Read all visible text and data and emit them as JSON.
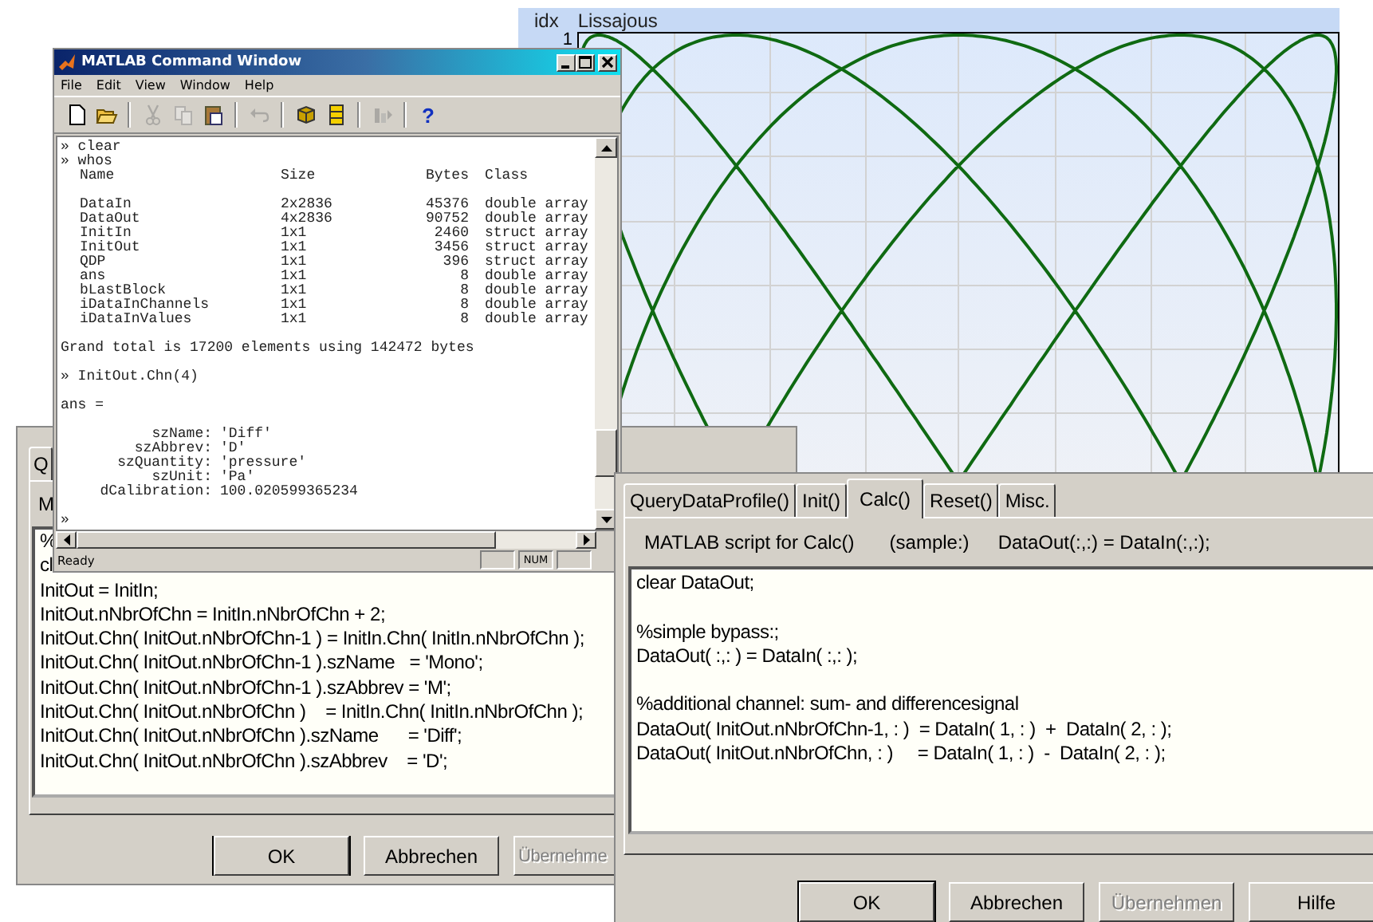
{
  "plot_window": {
    "header": {
      "column_1": "idx",
      "column_2": "Lissajous"
    },
    "y_tick": "1"
  },
  "back_dialog": {
    "tabs": [
      {
        "label": "Q",
        "selected": false
      }
    ],
    "script_label": "M",
    "editor": {
      "blocks": [
        [
          "%",
          "cl",
          "InitOut = InitIn;",
          "InitOut.nNbrOfChn = InitIn.nNbrOfChn + 2;",
          "InitOut.Chn( InitOut.nNbrOfChn-1 ) = InitIn.Chn( InitIn.nNbrOfChn );",
          "InitOut.Chn( InitOut.nNbrOfChn-1 ).szName   = 'Mono';",
          "InitOut.Chn( InitOut.nNbrOfChn-1 ).szAbbrev = 'M';",
          "InitOut.Chn( InitOut.nNbrOfChn )    = InitIn.Chn( InitIn.nNbrOfChn );",
          "InitOut.Chn( InitOut.nNbrOfChn ).szName      = 'Diff';",
          "InitOut.Chn( InitOut.nNbrOfChn ).szAbbrev    = 'D';"
        ]
      ]
    },
    "buttons": [
      {
        "label": "OK",
        "disabled": false,
        "default": true
      },
      {
        "label": "Abbrechen",
        "disabled": false,
        "default": false
      },
      {
        "label": "Übernehme",
        "disabled": true,
        "default": false
      }
    ]
  },
  "matlab_window": {
    "title": "MATLAB Command Window",
    "menu": [
      "File",
      "Edit",
      "View",
      "Window",
      "Help"
    ],
    "toolbar": [
      [
        {
          "kind": "new",
          "disabled": false
        },
        {
          "kind": "open",
          "disabled": false
        }
      ],
      [
        {
          "kind": "cut",
          "disabled": true
        },
        {
          "kind": "copy",
          "disabled": true
        },
        {
          "kind": "paste",
          "disabled": false
        }
      ],
      [
        {
          "kind": "undo",
          "disabled": true
        }
      ],
      [
        {
          "kind": "cube",
          "disabled": false
        },
        {
          "kind": "grid",
          "disabled": false
        }
      ],
      [
        {
          "kind": "profiler",
          "disabled": true
        }
      ],
      [
        {
          "kind": "help",
          "label": "?",
          "disabled": false
        }
      ]
    ],
    "console": [
      {
        "kind": "line",
        "text": "» clear"
      },
      {
        "kind": "line",
        "text": "» whos"
      },
      {
        "kind": "table",
        "columns": [
          "Name",
          "Size",
          "Bytes",
          "Class"
        ],
        "rows": [
          [
            "DataIn",
            "2x2836",
            "45376",
            "double array"
          ],
          [
            "DataOut",
            "4x2836",
            "90752",
            "double array"
          ],
          [
            "InitIn",
            "1x1",
            "2460",
            "struct array"
          ],
          [
            "InitOut",
            "1x1",
            "3456",
            "struct array"
          ],
          [
            "QDP",
            "1x1",
            "396",
            "struct array"
          ],
          [
            "ans",
            "1x1",
            "8",
            "double array"
          ],
          [
            "bLastBlock",
            "1x1",
            "8",
            "double array"
          ],
          [
            "iDataInChannels",
            "1x1",
            "8",
            "double array"
          ],
          [
            "iDataInValues",
            "1x1",
            "8",
            "double array"
          ]
        ]
      },
      {
        "kind": "blank"
      },
      {
        "kind": "line",
        "text": "Grand total is 17200 elements using 142472 bytes"
      },
      {
        "kind": "blank"
      },
      {
        "kind": "line",
        "text": "» InitOut.Chn(4)"
      },
      {
        "kind": "blank"
      },
      {
        "kind": "line",
        "text": "ans ="
      },
      {
        "kind": "blank"
      },
      {
        "kind": "fields",
        "items": [
          {
            "label": "szName:",
            "value": "'Diff'"
          },
          {
            "label": "szAbbrev:",
            "value": "'D'"
          },
          {
            "label": "szQuantity:",
            "value": "'pressure'"
          },
          {
            "label": "szUnit:",
            "value": "'Pa'"
          },
          {
            "label": "dCalibration:",
            "value": "100.020599365234"
          }
        ]
      },
      {
        "kind": "blank"
      },
      {
        "kind": "line",
        "text": "»"
      }
    ],
    "status": {
      "text": "Ready",
      "indicator": "NUM"
    }
  },
  "front_dialog": {
    "tabs": [
      {
        "label": "QueryDataProfile()",
        "selected": false
      },
      {
        "label": "Init()",
        "selected": false
      },
      {
        "label": "Calc()",
        "selected": true
      },
      {
        "label": "Reset()",
        "selected": false
      },
      {
        "label": "Misc.",
        "selected": false
      }
    ],
    "script_label": "MATLAB script for Calc()",
    "sample_label": "(sample:)",
    "sample_code": "DataOut(:,:) = DataIn(:,:);",
    "editor": {
      "blocks": [
        [
          "clear DataOut;"
        ],
        [
          "%simple bypass:;",
          "DataOut( :,: ) = DataIn( :,: );"
        ],
        [
          "%additional channel: sum- and differencesignal",
          "DataOut( InitOut.nNbrOfChn-1, : )  = DataIn( 1, : )  +  DataIn( 2, : );",
          "DataOut( InitOut.nNbrOfChn, : )     = DataIn( 1, : )  -  DataIn( 2, : );"
        ]
      ]
    },
    "buttons": [
      {
        "label": "OK",
        "disabled": false,
        "default": true
      },
      {
        "label": "Abbrechen",
        "disabled": false,
        "default": false
      },
      {
        "label": "Übernehmen",
        "disabled": true,
        "default": false
      },
      {
        "label": "Hilfe",
        "disabled": false,
        "default": false
      }
    ]
  }
}
